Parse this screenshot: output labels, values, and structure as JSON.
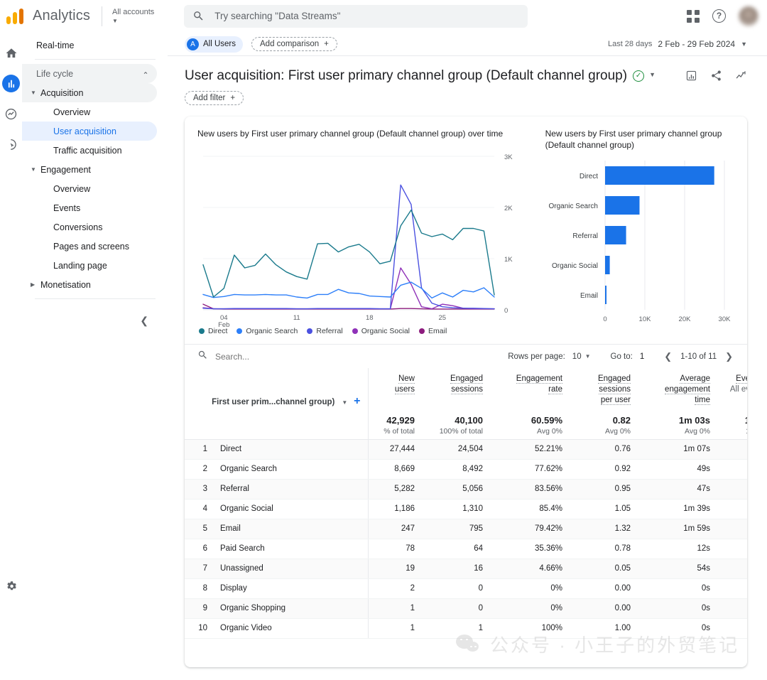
{
  "topbar": {
    "brand": "Analytics",
    "account_label": "All accounts",
    "search_placeholder": "Try searching \"Data Streams\"",
    "search_value": "",
    "apps_icon": "apps-grid-icon",
    "help_icon": "help-circle-icon",
    "avatar_icon": "user-avatar"
  },
  "rail": {
    "items": [
      {
        "name": "home",
        "icon": "home-icon"
      },
      {
        "name": "reports",
        "icon": "reports-bar-chart-icon",
        "active": true
      },
      {
        "name": "explore",
        "icon": "explore-icon"
      },
      {
        "name": "advertising",
        "icon": "advertising-cursor-icon"
      },
      {
        "name": "admin",
        "icon": "gear-icon"
      }
    ]
  },
  "sidebar": {
    "realtime": "Real-time",
    "life_cycle": "Life cycle",
    "groups": [
      {
        "label": "Acquisition",
        "expanded": true,
        "active_group": true,
        "children": [
          "Overview",
          "User acquisition",
          "Traffic acquisition"
        ]
      },
      {
        "label": "Engagement",
        "expanded": true,
        "active_group": false,
        "children": [
          "Overview",
          "Events",
          "Conversions",
          "Pages and screens",
          "Landing page"
        ]
      },
      {
        "label": "Monetisation",
        "expanded": false,
        "active_group": false,
        "children": []
      }
    ],
    "active_child": "User acquisition",
    "collapse_icon": "chevron-left-icon"
  },
  "controls": {
    "audience_chip": "All Users",
    "audience_initial": "A",
    "add_comparison": "Add comparison",
    "date_preset": "Last 28 days",
    "date_range": "2 Feb - 29 Feb 2024",
    "add_filter": "Add filter"
  },
  "header": {
    "title": "User acquisition: First user primary channel group (Default channel group)",
    "verified_icon": "check-circle-icon",
    "actions": [
      {
        "name": "insights-icon"
      },
      {
        "name": "share-icon"
      },
      {
        "name": "trend-line-icon"
      }
    ]
  },
  "chart_data": [
    {
      "type": "line",
      "title": "New users by First user primary channel group (Default channel group) over time",
      "xlabel": "",
      "ylabel": "",
      "ylim": [
        0,
        3000
      ],
      "yticks": [
        "0",
        "1K",
        "2K",
        "3K"
      ],
      "xticks": [
        "04\nFeb",
        "11",
        "18",
        "25"
      ],
      "grid": true,
      "legend_position": "bottom",
      "x": [
        1,
        2,
        3,
        4,
        5,
        6,
        7,
        8,
        9,
        10,
        11,
        12,
        13,
        14,
        15,
        16,
        17,
        18,
        19,
        20,
        21,
        22,
        23,
        24,
        25,
        26,
        27,
        28
      ],
      "series": [
        {
          "name": "Direct",
          "color": "#1a7a8c",
          "values": [
            880,
            250,
            420,
            1070,
            820,
            870,
            1090,
            880,
            740,
            650,
            600,
            1290,
            1300,
            1130,
            1230,
            1280,
            1130,
            900,
            950,
            1640,
            1950,
            1500,
            1430,
            1480,
            1370,
            1590,
            1590,
            1540,
            290
          ]
        },
        {
          "name": "Organic Search",
          "color": "#2d7ff9",
          "values": [
            300,
            240,
            260,
            300,
            290,
            290,
            300,
            290,
            290,
            250,
            230,
            300,
            300,
            400,
            330,
            320,
            270,
            260,
            250,
            480,
            540,
            420,
            230,
            330,
            250,
            380,
            350,
            430,
            250
          ]
        },
        {
          "name": "Referral",
          "color": "#4b51e0",
          "values": [
            30,
            20,
            20,
            25,
            25,
            25,
            25,
            25,
            25,
            20,
            20,
            25,
            25,
            25,
            25,
            25,
            25,
            20,
            20,
            2440,
            2060,
            430,
            130,
            60,
            40,
            30,
            30,
            25,
            20
          ]
        },
        {
          "name": "Organic Social",
          "color": "#8f31b8",
          "values": [
            40,
            20,
            20,
            20,
            20,
            20,
            20,
            20,
            20,
            20,
            20,
            20,
            20,
            20,
            20,
            20,
            20,
            20,
            20,
            820,
            500,
            60,
            20,
            110,
            80,
            30,
            20,
            20,
            20
          ]
        },
        {
          "name": "Email",
          "color": "#8d1c7e",
          "values": [
            110,
            20,
            15,
            15,
            15,
            15,
            15,
            15,
            15,
            15,
            15,
            15,
            15,
            15,
            15,
            15,
            15,
            15,
            15,
            25,
            25,
            20,
            15,
            15,
            15,
            15,
            15,
            15,
            15
          ]
        }
      ]
    },
    {
      "type": "bar",
      "orientation": "horizontal",
      "title": "New users by First user primary channel group (Default channel group)",
      "categories": [
        "Direct",
        "Organic Search",
        "Referral",
        "Organic Social",
        "Email"
      ],
      "values": [
        27444,
        8669,
        5282,
        1186,
        247
      ],
      "bar_color": "#1a73e8",
      "xticks": [
        "0",
        "10K",
        "20K",
        "30K"
      ],
      "xlim": [
        0,
        30000
      ],
      "grid": true
    }
  ],
  "table_controls": {
    "search_placeholder": "Search...",
    "search_value": "",
    "rows_per_page_label": "Rows per page:",
    "rows_per_page_value": "10",
    "goto_label": "Go to:",
    "goto_value": "1",
    "range_label": "1-10 of 11",
    "prev_icon": "chevron-left-icon",
    "next_icon": "chevron-right-icon",
    "search_icon": "search-icon"
  },
  "table": {
    "dimension_label": "First user prim...channel group)",
    "dimension_caret": "caret-down-icon",
    "add_dimension_icon": "plus-icon",
    "columns": [
      {
        "line1": "New",
        "line2": "users",
        "line3": "",
        "total": "42,929",
        "sub": "% of total"
      },
      {
        "line1": "Engaged",
        "line2": "sessions",
        "line3": "",
        "total": "40,100",
        "sub": "100% of total"
      },
      {
        "line1": "Engagement",
        "line2": "rate",
        "line3": "",
        "total": "60.59%",
        "sub": "Avg 0%"
      },
      {
        "line1": "Engaged",
        "line2": "sessions",
        "line3": "per user",
        "total": "0.82",
        "sub": "Avg 0%"
      },
      {
        "line1": "Average",
        "line2": "engagement",
        "line3": "time",
        "total": "1m 03s",
        "sub": "Avg 0%"
      },
      {
        "line1": "Eve",
        "line2": "All ev",
        "line3": "",
        "total": "1",
        "sub": "1"
      }
    ],
    "rows": [
      {
        "idx": "1",
        "name": "Direct",
        "v": [
          "27,444",
          "24,504",
          "52.21%",
          "0.76",
          "1m 07s",
          ""
        ]
      },
      {
        "idx": "2",
        "name": "Organic Search",
        "v": [
          "8,669",
          "8,492",
          "77.62%",
          "0.92",
          "49s",
          ""
        ]
      },
      {
        "idx": "3",
        "name": "Referral",
        "v": [
          "5,282",
          "5,056",
          "83.56%",
          "0.95",
          "47s",
          ""
        ]
      },
      {
        "idx": "4",
        "name": "Organic Social",
        "v": [
          "1,186",
          "1,310",
          "85.4%",
          "1.05",
          "1m 39s",
          ""
        ]
      },
      {
        "idx": "5",
        "name": "Email",
        "v": [
          "247",
          "795",
          "79.42%",
          "1.32",
          "1m 59s",
          ""
        ]
      },
      {
        "idx": "6",
        "name": "Paid Search",
        "v": [
          "78",
          "64",
          "35.36%",
          "0.78",
          "12s",
          ""
        ]
      },
      {
        "idx": "7",
        "name": "Unassigned",
        "v": [
          "19",
          "16",
          "4.66%",
          "0.05",
          "54s",
          ""
        ]
      },
      {
        "idx": "8",
        "name": "Display",
        "v": [
          "2",
          "0",
          "0%",
          "0.00",
          "0s",
          ""
        ]
      },
      {
        "idx": "9",
        "name": "Organic Shopping",
        "v": [
          "1",
          "0",
          "0%",
          "0.00",
          "0s",
          ""
        ]
      },
      {
        "idx": "10",
        "name": "Organic Video",
        "v": [
          "1",
          "1",
          "100%",
          "1.00",
          "0s",
          ""
        ]
      }
    ]
  },
  "watermark": {
    "text": "公众号 · 小王子的外贸笔记",
    "icon": "wechat-icon"
  }
}
